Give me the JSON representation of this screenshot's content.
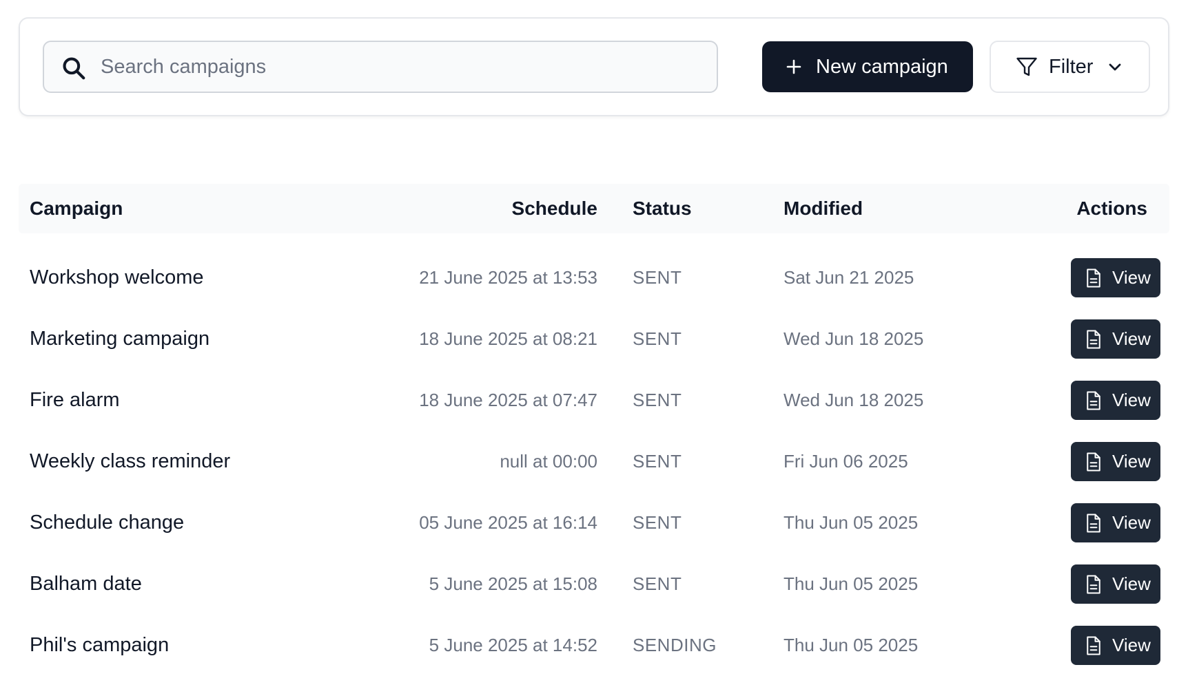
{
  "search": {
    "placeholder": "Search campaigns",
    "value": ""
  },
  "toolbar": {
    "new_label": "New campaign",
    "filter_label": "Filter"
  },
  "table": {
    "headers": {
      "campaign": "Campaign",
      "schedule": "Schedule",
      "status": "Status",
      "modified": "Modified",
      "actions": "Actions"
    },
    "view_label": "View",
    "rows": [
      {
        "name": "Workshop welcome",
        "schedule": "21 June 2025 at 13:53",
        "status": "SENT",
        "modified": "Sat Jun 21 2025"
      },
      {
        "name": "Marketing campaign",
        "schedule": "18 June 2025 at 08:21",
        "status": "SENT",
        "modified": "Wed Jun 18 2025"
      },
      {
        "name": "Fire alarm",
        "schedule": "18 June 2025 at 07:47",
        "status": "SENT",
        "modified": "Wed Jun 18 2025"
      },
      {
        "name": "Weekly class reminder",
        "schedule": "null at 00:00",
        "status": "SENT",
        "modified": "Fri Jun 06 2025"
      },
      {
        "name": "Schedule change",
        "schedule": "05 June 2025 at 16:14",
        "status": "SENT",
        "modified": "Thu Jun 05 2025"
      },
      {
        "name": "Balham date",
        "schedule": "5 June 2025 at 15:08",
        "status": "SENT",
        "modified": "Thu Jun 05 2025"
      },
      {
        "name": "Phil's campaign",
        "schedule": "5 June 2025 at 14:52",
        "status": "SENDING",
        "modified": "Thu Jun 05 2025"
      }
    ]
  }
}
